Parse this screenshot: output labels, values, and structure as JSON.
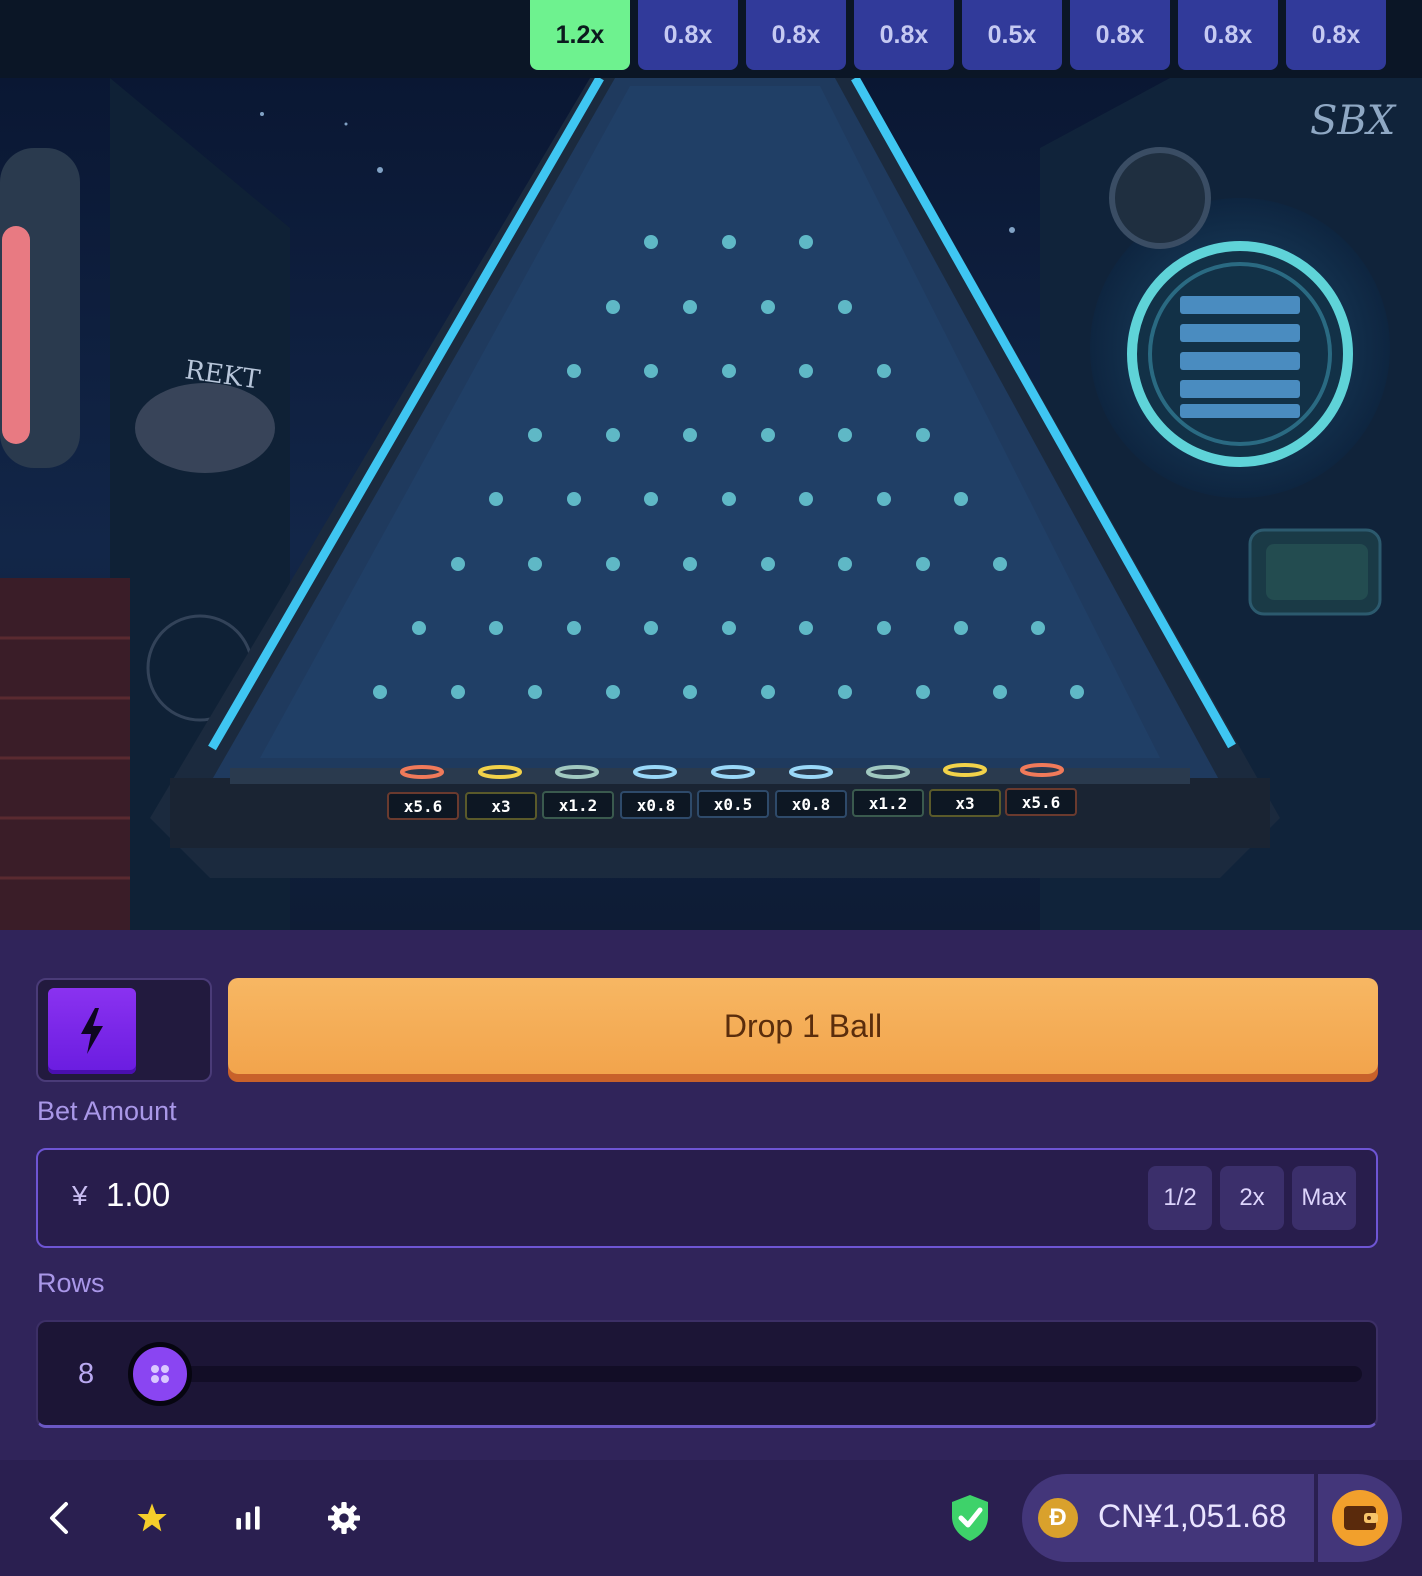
{
  "history": [
    "1.2x",
    "0.8x",
    "0.8x",
    "0.8x",
    "0.5x",
    "0.8x",
    "0.8x",
    "0.8x"
  ],
  "board": {
    "multipliers": [
      "x5.6",
      "x3",
      "x1.2",
      "x0.8",
      "x0.5",
      "x0.8",
      "x1.2",
      "x3",
      "x5.6"
    ],
    "graffiti_left": "REKT",
    "graffiti_right": "SBX"
  },
  "controls": {
    "drop_label": "Drop 1 Ball",
    "bet_label": "Bet Amount",
    "currency_symbol": "¥",
    "bet_value": "1.00",
    "half_label": "1/2",
    "double_label": "2x",
    "max_label": "Max",
    "rows_label": "Rows",
    "rows_value": "8",
    "rows_fill": 0
  },
  "footer": {
    "balance": "CN¥1,051.68",
    "coin_symbol": "Ð"
  },
  "colors": {
    "accent": "#f2a44c",
    "win": "#6ef28f",
    "chip": "#313a9a",
    "panel": "#30245a"
  }
}
